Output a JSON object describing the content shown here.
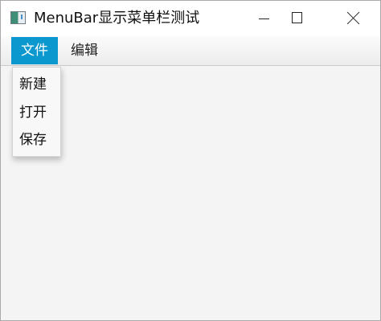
{
  "window": {
    "title": "MenuBar显示菜单栏测试"
  },
  "menubar": {
    "menus": [
      {
        "label": "文件",
        "active": true
      },
      {
        "label": "编辑",
        "active": false
      }
    ]
  },
  "file_menu": {
    "items": [
      {
        "label": "新建"
      },
      {
        "label": "打开"
      },
      {
        "label": "保存"
      }
    ]
  },
  "colors": {
    "menu_highlight": "#0B98CF",
    "window_background": "#F4F4F4"
  },
  "icons": [
    "app-icon",
    "minimize-icon",
    "maximize-icon",
    "close-icon"
  ]
}
